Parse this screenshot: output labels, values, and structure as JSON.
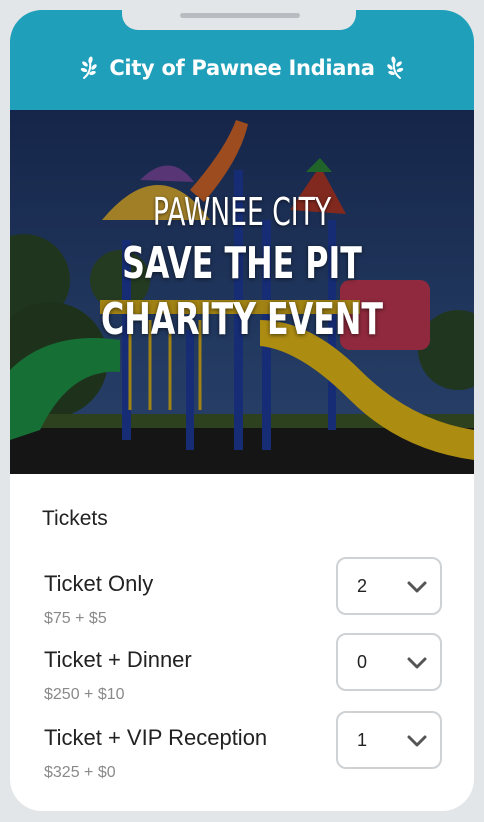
{
  "header": {
    "title": "City of Pawnee Indiana",
    "color": "#1f9fb9",
    "left_icon": "laurel-icon",
    "right_icon": "laurel-icon"
  },
  "hero": {
    "line1": "PAWNEE CITY",
    "line2": "SAVE THE PIT",
    "line3": "CHARITY EVENT"
  },
  "tickets": {
    "title": "Tickets",
    "items": [
      {
        "name": "Ticket Only",
        "price": "$75 + $5",
        "quantity": "2"
      },
      {
        "name": "Ticket + Dinner",
        "price": "$250 + $10",
        "quantity": "0"
      },
      {
        "name": "Ticket + VIP Reception",
        "price": "$325 + $0",
        "quantity": "1"
      }
    ]
  }
}
